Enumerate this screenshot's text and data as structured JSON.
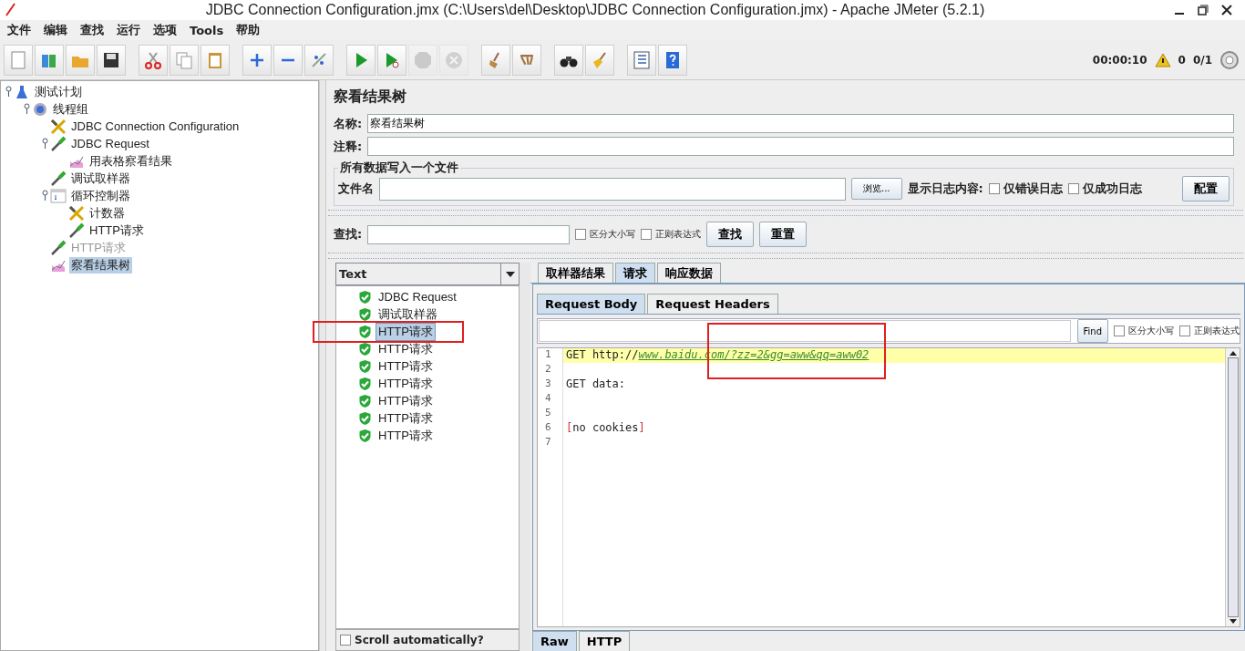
{
  "window": {
    "title": "JDBC Connection Configuration.jmx (C:\\Users\\del\\Desktop\\JDBC Connection Configuration.jmx) - Apache JMeter (5.2.1)"
  },
  "menu": [
    {
      "label": "文件"
    },
    {
      "label": "编辑"
    },
    {
      "label": "查找"
    },
    {
      "label": "运行"
    },
    {
      "label": "选项"
    },
    {
      "label": "Tools"
    },
    {
      "label": "帮助"
    }
  ],
  "toolbar": [
    {
      "kind": "new",
      "disabled": false
    },
    {
      "kind": "templates",
      "disabled": false
    },
    {
      "kind": "open",
      "disabled": false
    },
    {
      "kind": "save",
      "disabled": false
    },
    {
      "kind": "sep"
    },
    {
      "kind": "cut",
      "disabled": false
    },
    {
      "kind": "copy",
      "disabled": false
    },
    {
      "kind": "paste",
      "disabled": false
    },
    {
      "kind": "sep"
    },
    {
      "kind": "expand",
      "disabled": false
    },
    {
      "kind": "collapse",
      "disabled": false
    },
    {
      "kind": "toggle",
      "disabled": false
    },
    {
      "kind": "sep"
    },
    {
      "kind": "start",
      "disabled": false
    },
    {
      "kind": "start-no-pause",
      "disabled": false
    },
    {
      "kind": "stop",
      "disabled": true
    },
    {
      "kind": "shutdown",
      "disabled": true
    },
    {
      "kind": "sep"
    },
    {
      "kind": "clear",
      "disabled": false
    },
    {
      "kind": "clear-all",
      "disabled": false
    },
    {
      "kind": "sep"
    },
    {
      "kind": "search",
      "disabled": false
    },
    {
      "kind": "reset-search",
      "disabled": false
    },
    {
      "kind": "sep"
    },
    {
      "kind": "function-helper",
      "disabled": false
    },
    {
      "kind": "help",
      "disabled": false
    }
  ],
  "status": {
    "elapsed": "00:00:10",
    "errors": "0",
    "threads": "0/1"
  },
  "tree": [
    {
      "label": "测试计划",
      "kind": "plan",
      "disabled": false,
      "selected": false,
      "children": [
        {
          "label": "线程组",
          "kind": "threadgroup",
          "disabled": false,
          "selected": false,
          "children": [
            {
              "label": "JDBC Connection Configuration",
              "kind": "config",
              "disabled": false,
              "selected": false
            },
            {
              "label": "JDBC Request",
              "kind": "sampler",
              "disabled": false,
              "selected": false,
              "children": [
                {
                  "label": "用表格察看结果",
                  "kind": "listener",
                  "disabled": false,
                  "selected": false
                }
              ]
            },
            {
              "label": "调试取样器",
              "kind": "sampler",
              "disabled": false,
              "selected": false
            },
            {
              "label": "循环控制器",
              "kind": "controller",
              "disabled": false,
              "selected": false,
              "children": [
                {
                  "label": "计数器",
                  "kind": "config",
                  "disabled": false,
                  "selected": false
                },
                {
                  "label": "HTTP请求",
                  "kind": "sampler",
                  "disabled": false,
                  "selected": false
                }
              ]
            },
            {
              "label": "HTTP请求",
              "kind": "sampler",
              "disabled": true,
              "selected": false
            },
            {
              "label": "察看结果树",
              "kind": "listener",
              "disabled": false,
              "selected": true
            }
          ]
        }
      ]
    }
  ],
  "panel": {
    "title": "察看结果树",
    "name_label": "名称:",
    "name_value": "察看结果树",
    "comment_label": "注释:",
    "file_group": {
      "title": "所有数据写入一个文件",
      "file_label": "文件名",
      "browse": "浏览...",
      "log_label": "显示日志内容:",
      "errors_only": {
        "label": "仅错误日志",
        "checked": false
      },
      "success_only": {
        "label": "仅成功日志",
        "checked": false
      },
      "configure": "配置"
    },
    "search": {
      "label": "查找:",
      "case": {
        "label": "区分大小写",
        "checked": false
      },
      "regex": {
        "label": "正则表达式",
        "checked": false
      },
      "find": "查找",
      "reset": "重置"
    }
  },
  "results": {
    "renderer": "Text",
    "scroll_auto": {
      "label": "Scroll automatically?",
      "checked": false
    },
    "items": [
      {
        "label": "JDBC Request",
        "selected": false,
        "annotated": false
      },
      {
        "label": "调试取样器",
        "selected": false,
        "annotated": false
      },
      {
        "label": "HTTP请求",
        "selected": true,
        "annotated": true
      },
      {
        "label": "HTTP请求",
        "selected": false,
        "annotated": false
      },
      {
        "label": "HTTP请求",
        "selected": false,
        "annotated": false
      },
      {
        "label": "HTTP请求",
        "selected": false,
        "annotated": false
      },
      {
        "label": "HTTP请求",
        "selected": false,
        "annotated": false
      },
      {
        "label": "HTTP请求",
        "selected": false,
        "annotated": false
      },
      {
        "label": "HTTP请求",
        "selected": false,
        "annotated": false
      }
    ]
  },
  "detail_tabs": [
    {
      "label": "取样器结果",
      "selected": false
    },
    {
      "label": "请求",
      "selected": true
    },
    {
      "label": "响应数据",
      "selected": false
    }
  ],
  "request_tabs": [
    {
      "label": "Request Body",
      "selected": true
    },
    {
      "label": "Request Headers",
      "selected": false
    }
  ],
  "find_bar": {
    "button": "Find",
    "case": {
      "label": "区分大小写",
      "checked": false
    },
    "regex": {
      "label": "正则表达式",
      "checked": false
    }
  },
  "code_view": {
    "annotated": true,
    "lines": [
      {
        "num": "1",
        "kind": "link",
        "text": "GET http://",
        "link": "www.baidu.com/?zz=2&gg=aww&qq=aww02",
        "current": true
      },
      {
        "num": "2",
        "kind": "empty",
        "current": false
      },
      {
        "num": "3",
        "kind": "plain",
        "text": "GET data:",
        "current": false
      },
      {
        "num": "4",
        "kind": "empty",
        "current": false
      },
      {
        "num": "5",
        "kind": "empty",
        "current": false
      },
      {
        "num": "6",
        "kind": "bracketed",
        "open": "[",
        "text": "no cookies",
        "close": "]",
        "current": false
      },
      {
        "num": "7",
        "kind": "empty",
        "current": false
      }
    ]
  },
  "view_tabs": [
    {
      "label": "Raw",
      "selected": true
    },
    {
      "label": "HTTP",
      "selected": false
    }
  ]
}
